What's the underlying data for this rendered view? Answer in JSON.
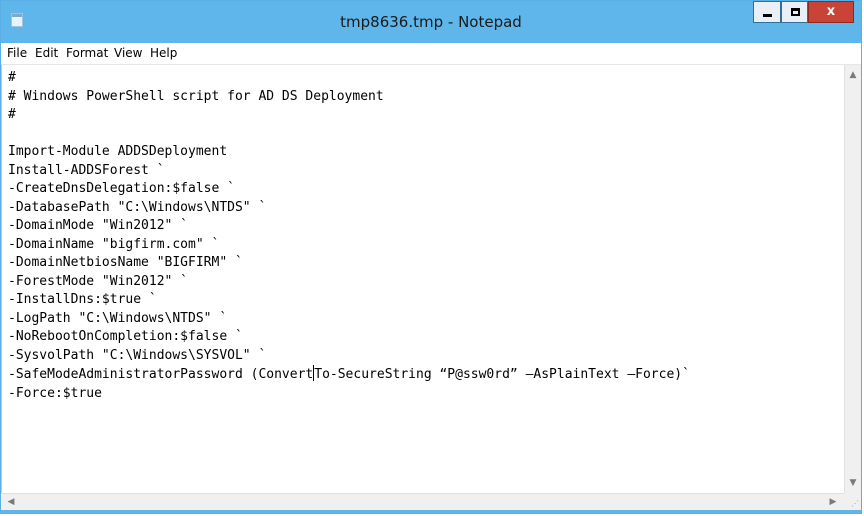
{
  "window": {
    "title": "tmp8636.tmp - Notepad",
    "close_glyph": "x",
    "icons": [
      "notepad-icon",
      "minimize-icon",
      "maximize-icon",
      "close-icon"
    ]
  },
  "menu": {
    "file": "File",
    "edit": "Edit",
    "format": "Format",
    "view": "View",
    "help": "Help"
  },
  "editor": {
    "before_caret": "#\n# Windows PowerShell script for AD DS Deployment\n#\n\nImport-Module ADDSDeployment\nInstall-ADDSForest `\n-CreateDnsDelegation:$false `\n-DatabasePath \"C:\\Windows\\NTDS\" `\n-DomainMode \"Win2012\" `\n-DomainName \"bigfirm.com\" `\n-DomainNetbiosName \"BIGFIRM\" `\n-ForestMode \"Win2012\" `\n-InstallDns:$true `\n-LogPath \"C:\\Windows\\NTDS\" `\n-NoRebootOnCompletion:$false `\n-SysvolPath \"C:\\Windows\\SYSVOL\" `\n-SafeModeAdministratorPassword (Convert",
    "after_caret": "To-SecureString “P@ssw0rd” –AsPlainText –Force)`\n-Force:$true"
  },
  "scrollbars": {
    "up": "▲",
    "down": "▼",
    "left": "◀",
    "right": "▶",
    "grip": "⋰"
  }
}
